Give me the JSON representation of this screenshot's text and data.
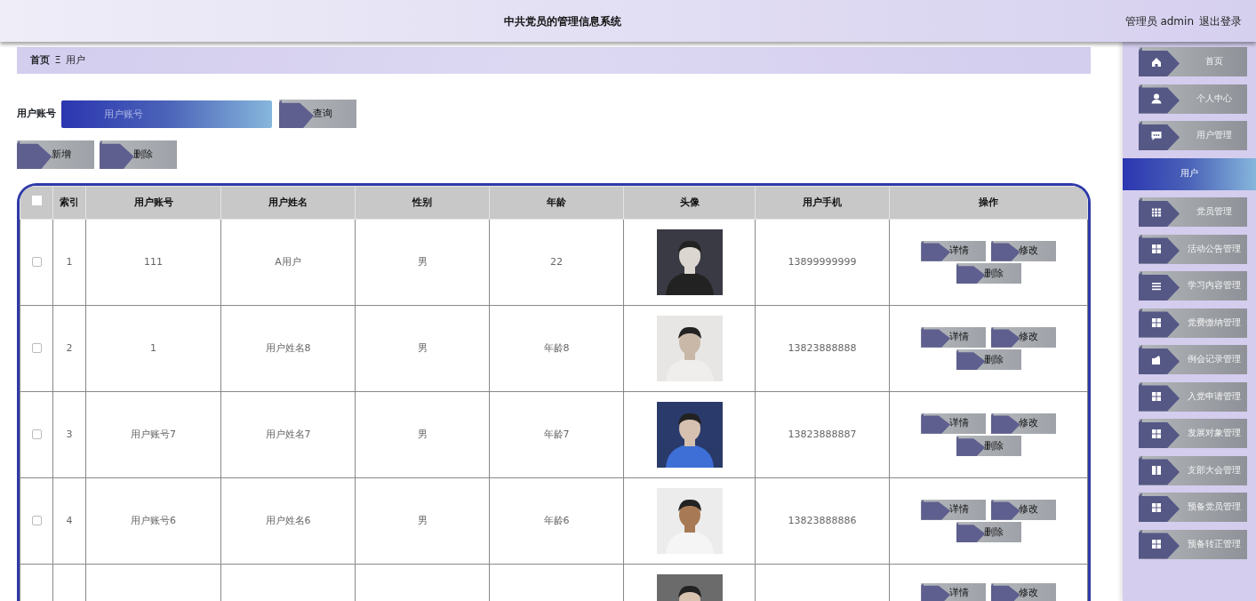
{
  "header": {
    "title": "中共党员的管理信息系统",
    "user": "管理员 admin",
    "logout": "退出登录"
  },
  "breadcrumb": {
    "home": "首页",
    "separator": "Ξ",
    "current": "用户"
  },
  "search": {
    "label": "用户账号",
    "placeholder": "用户账号",
    "button": "查询"
  },
  "actions": [
    "新增",
    "删除"
  ],
  "table": {
    "header_checked": false,
    "columns": [
      "索引",
      "用户账号",
      "用户姓名",
      "性别",
      "年龄",
      "头像",
      "用户手机",
      "操作"
    ],
    "rows": [
      {
        "selected": false,
        "cells": [
          "1",
          "111",
          "A用户",
          "男",
          "22",
          "13899999999"
        ],
        "buttons": [
          "详情",
          "修改",
          "删除"
        ]
      },
      {
        "selected": false,
        "cells": [
          "2",
          "1",
          "用户姓名8",
          "男",
          "年龄8",
          "13823888888"
        ],
        "buttons": [
          "详情",
          "修改",
          "删除"
        ]
      },
      {
        "selected": false,
        "cells": [
          "3",
          "用户账号7",
          "用户姓名7",
          "男",
          "年龄7",
          "13823888887"
        ],
        "buttons": [
          "详情",
          "修改",
          "删除"
        ]
      },
      {
        "selected": false,
        "cells": [
          "4",
          "用户账号6",
          "用户姓名6",
          "男",
          "年龄6",
          "13823888886"
        ],
        "buttons": [
          "详情",
          "修改",
          "删除"
        ]
      },
      {
        "cells": [],
        "buttons": [
          "详情",
          "修改"
        ]
      }
    ]
  },
  "sidebar": {
    "items": [
      {
        "label": "首页",
        "selected": false
      },
      {
        "label": "个人中心",
        "selected": false
      },
      {
        "label": "用户管理",
        "selected": false
      },
      {
        "label": "用户",
        "selected": true
      },
      {
        "label": "党员管理",
        "selected": false
      },
      {
        "label": "活动公告管理",
        "selected": false
      },
      {
        "label": "学习内容管理",
        "selected": false
      },
      {
        "label": "党费缴纳管理",
        "selected": false
      },
      {
        "label": "例会记录管理",
        "selected": false
      },
      {
        "label": "入党申请管理",
        "selected": false
      },
      {
        "label": "发展对象管理",
        "selected": false
      },
      {
        "label": "支部大会管理",
        "selected": false
      },
      {
        "label": "预备党员管理",
        "selected": false
      },
      {
        "label": "预备转正管理",
        "selected": false
      }
    ]
  }
}
